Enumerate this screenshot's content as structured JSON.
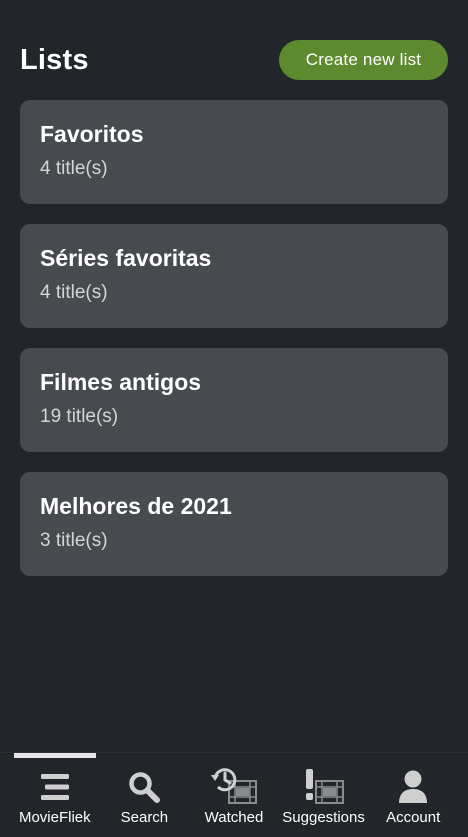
{
  "header": {
    "title": "Lists",
    "create_button_label": "Create new list"
  },
  "lists": [
    {
      "name": "Favoritos",
      "count": "4 title(s)"
    },
    {
      "name": "Séries favoritas",
      "count": "4 title(s)"
    },
    {
      "name": "Filmes antigos",
      "count": "19 title(s)"
    },
    {
      "name": "Melhores de 2021",
      "count": "3 title(s)"
    }
  ],
  "nav": {
    "items": [
      {
        "label": "MovieFliek",
        "icon": "menu-icon"
      },
      {
        "label": "Search",
        "icon": "search-icon"
      },
      {
        "label": "Watched",
        "icon": "history-film-icon"
      },
      {
        "label": "Suggestions",
        "icon": "exclamation-film-icon"
      },
      {
        "label": "Account",
        "icon": "user-icon"
      }
    ],
    "active_index": 0
  },
  "colors": {
    "background": "#222529",
    "card": "#474a4f",
    "accent": "#5d8a2e",
    "icon": "#cfcfcf"
  }
}
